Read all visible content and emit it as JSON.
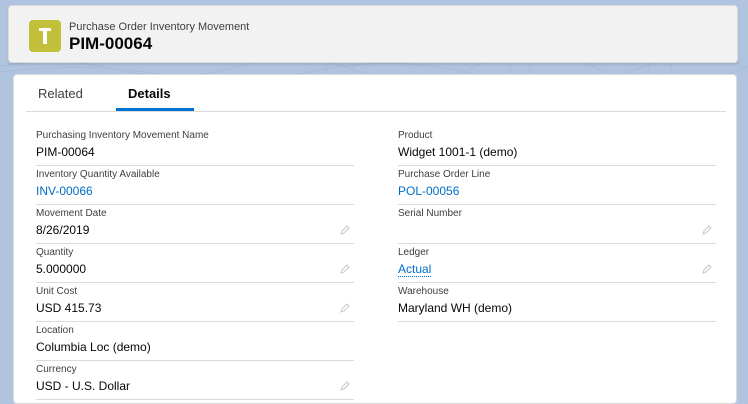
{
  "header": {
    "object_type": "Purchase Order Inventory Movement",
    "record_name": "PIM-00064",
    "icon": "lamp-icon",
    "icon_color": "#c2bf3b"
  },
  "tabs": [
    {
      "label": "Related",
      "active": false
    },
    {
      "label": "Details",
      "active": true
    }
  ],
  "fields": {
    "left": [
      {
        "label": "Purchasing Inventory Movement Name",
        "value": "PIM-00064",
        "link": false,
        "editable": false
      },
      {
        "label": "Inventory Quantity Available",
        "value": "INV-00066",
        "link": true,
        "editable": false
      },
      {
        "label": "Movement Date",
        "value": "8/26/2019",
        "link": false,
        "editable": true
      },
      {
        "label": "Quantity",
        "value": "5.000000",
        "link": false,
        "editable": true
      },
      {
        "label": "Unit Cost",
        "value": "USD 415.73",
        "link": false,
        "editable": true
      },
      {
        "label": "Location",
        "value": "Columbia Loc (demo)",
        "link": false,
        "editable": false
      },
      {
        "label": "Currency",
        "value": "USD - U.S. Dollar",
        "link": false,
        "editable": true
      }
    ],
    "right": [
      {
        "label": "Product",
        "value": "Widget 1001-1 (demo)",
        "link": false,
        "editable": false
      },
      {
        "label": "Purchase Order Line",
        "value": "POL-00056",
        "link": true,
        "editable": false
      },
      {
        "label": "Serial Number",
        "value": "",
        "link": false,
        "editable": true
      },
      {
        "label": "Ledger",
        "value": "Actual",
        "link": true,
        "editable": true
      },
      {
        "label": "Warehouse",
        "value": "Maryland WH (demo)",
        "link": false,
        "editable": false
      }
    ]
  },
  "colors": {
    "accent": "#0070d2",
    "link": "#006dcc",
    "background": "#b0c4df"
  }
}
